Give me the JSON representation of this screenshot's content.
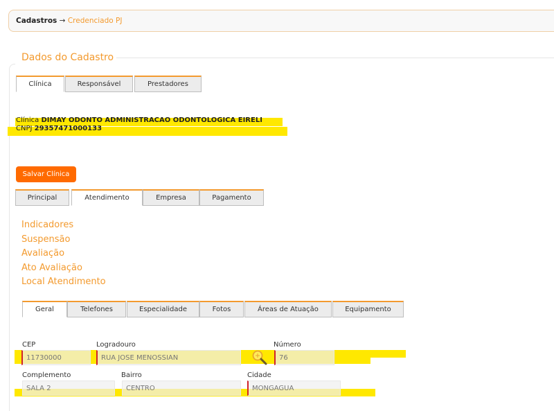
{
  "breadcrumb": {
    "root": "Cadastros",
    "separator": "→",
    "current": "Credenciado PJ"
  },
  "section_title": "Dados do Cadastro",
  "top_tabs": [
    {
      "label": "Clínica",
      "active": true
    },
    {
      "label": "Responsável",
      "active": false
    },
    {
      "label": "Prestadores",
      "active": false
    }
  ],
  "clinic": {
    "name_label": "Clínica",
    "name": "DIMAY ODONTO ADMINISTRACAO ODONTOLOGICA EIRELI",
    "cnpj_label": "CNPJ",
    "cnpj": "29357471000133"
  },
  "save_button": "Salvar Clínica",
  "sub_tabs": [
    {
      "label": "Principal",
      "active": false
    },
    {
      "label": "Atendimento",
      "active": true
    },
    {
      "label": "Empresa",
      "active": false
    },
    {
      "label": "Pagamento",
      "active": false
    }
  ],
  "links": [
    "Indicadores",
    "Suspensão",
    "Avaliação",
    "Ato Avaliação",
    "Local Atendimento"
  ],
  "inner_tabs": [
    {
      "label": "Geral",
      "active": true
    },
    {
      "label": "Telefones",
      "active": false
    },
    {
      "label": "Especialidade",
      "active": false
    },
    {
      "label": "Fotos",
      "active": false
    },
    {
      "label": "Áreas de Atuação",
      "active": false
    },
    {
      "label": "Equipamento",
      "active": false
    }
  ],
  "form": {
    "cep": {
      "label": "CEP",
      "value": "11730000"
    },
    "logradouro": {
      "label": "Logradouro",
      "value": "RUA JOSE MENOSSIAN"
    },
    "numero": {
      "label": "Número",
      "value": "76"
    },
    "complemento": {
      "label": "Complemento",
      "value": "SALA 2"
    },
    "bairro": {
      "label": "Bairro",
      "value": "CENTRO"
    },
    "cidade": {
      "label": "Cidade",
      "value": "MONGAGUA"
    }
  },
  "colors": {
    "accent": "#f39a2e",
    "button": "#ff6a00",
    "highlight": "#ffe800",
    "required": "#d0232a"
  }
}
